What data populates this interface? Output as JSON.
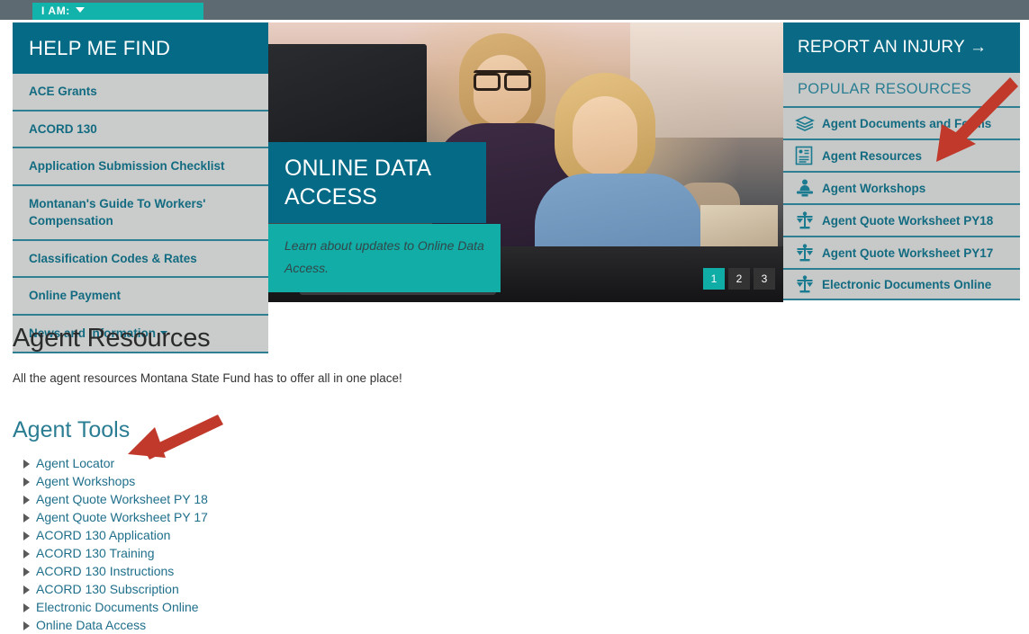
{
  "colors": {
    "topbar": "#5e6a71",
    "teal_accent": "#12b3ab",
    "dark_teal": "#056a85",
    "link_teal": "#136b81",
    "panel_gray": "#c9cccb",
    "annotation_red": "#c0392b"
  },
  "topbar": {
    "iam_label": "I AM:",
    "iam_icon": "chevron-down-icon"
  },
  "leftnav": {
    "header": "HELP ME FIND",
    "items": [
      {
        "label": "ACE Grants",
        "has_caret": false
      },
      {
        "label": "ACORD 130",
        "has_caret": false
      },
      {
        "label": "Application Submission Checklist",
        "has_caret": false
      },
      {
        "label": "Montanan's Guide To Workers' Compensation",
        "has_caret": false
      },
      {
        "label": "Classification Codes & Rates",
        "has_caret": false
      },
      {
        "label": "Online Payment",
        "has_caret": false
      },
      {
        "label": "News and Information",
        "has_caret": true
      }
    ]
  },
  "hero": {
    "title": "ONLINE DATA ACCESS",
    "subtitle": "Learn about updates to Online Data Access.",
    "pager": [
      {
        "label": "1",
        "active": true
      },
      {
        "label": "2",
        "active": false
      },
      {
        "label": "3",
        "active": false
      }
    ]
  },
  "rightrail": {
    "report_injury": "REPORT AN INJURY →",
    "popular_header": "POPULAR RESOURCES",
    "items": [
      {
        "label": "Agent Documents and Forms",
        "icon": "stacked-pages-icon"
      },
      {
        "label": "Agent Resources",
        "icon": "document-card-icon"
      },
      {
        "label": "Agent Workshops",
        "icon": "person-at-podium-icon"
      },
      {
        "label": "Agent Quote Worksheet PY18",
        "icon": "balance-scale-icon"
      },
      {
        "label": "Agent Quote Worksheet PY17",
        "icon": "balance-scale-icon"
      },
      {
        "label": "Electronic Documents Online",
        "icon": "balance-scale-icon"
      }
    ]
  },
  "main": {
    "page_title": "Agent Resources",
    "intro": "All the agent resources Montana State Fund has to offer all in one place!",
    "section_title": "Agent Tools",
    "tools": [
      "Agent Locator",
      "Agent Workshops",
      "Agent Quote Worksheet PY 18",
      "Agent Quote Worksheet PY 17",
      "ACORD 130 Application",
      "ACORD 130 Training",
      "ACORD 130 Instructions",
      "ACORD 130 Subscription",
      "Electronic Documents Online",
      "Online Data Access"
    ]
  },
  "annotations": [
    {
      "name": "arrow-to-agent-resources",
      "target": "Agent Resources"
    },
    {
      "name": "arrow-to-agent-locator",
      "target": "Agent Locator"
    }
  ]
}
